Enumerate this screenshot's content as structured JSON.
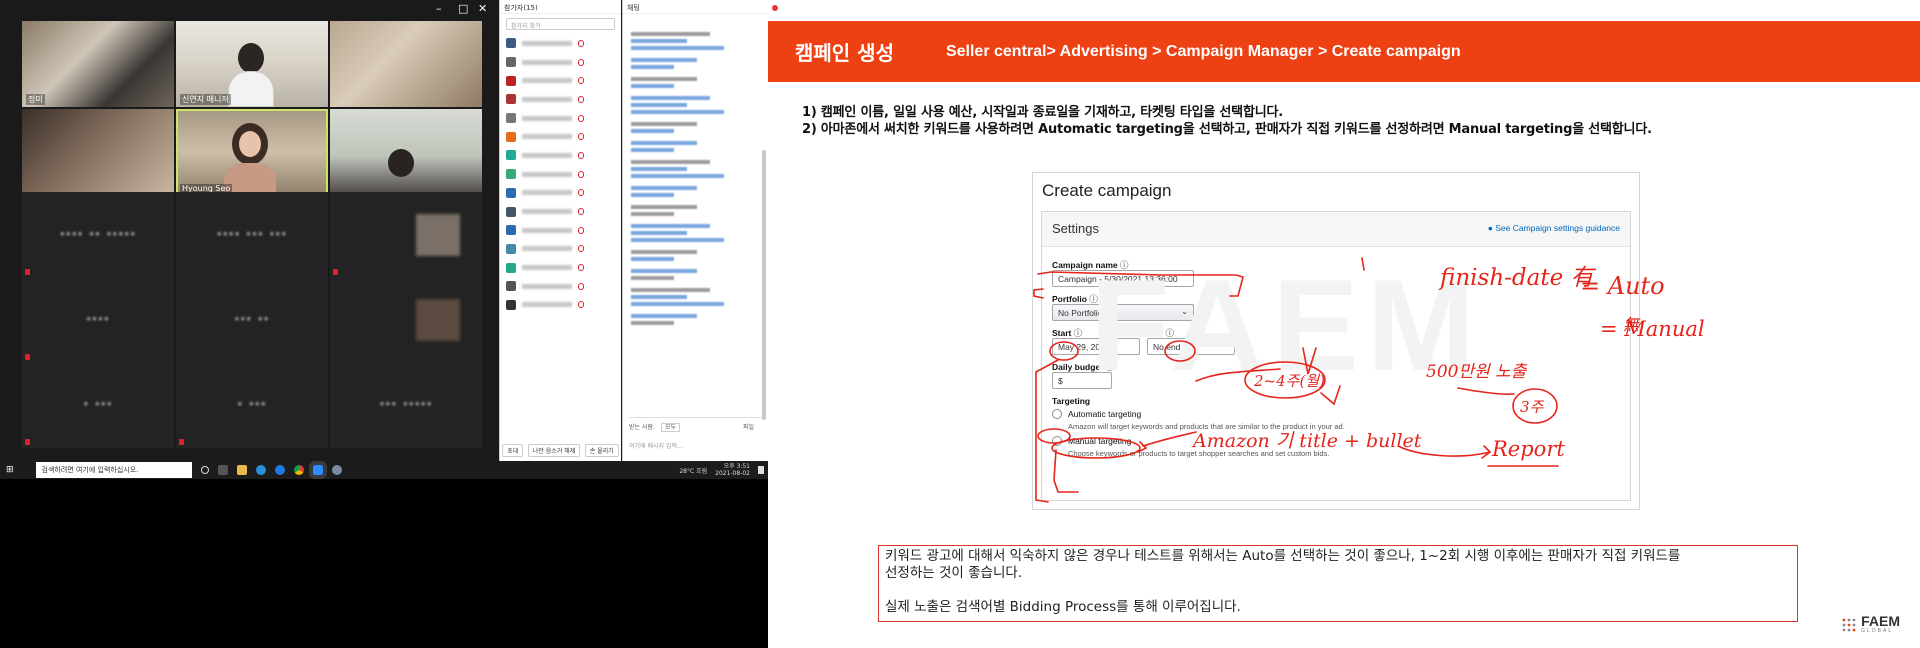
{
  "zoom": {
    "window_controls": [
      "–",
      "□",
      "✕"
    ],
    "tiles": [
      {
        "name": "정미"
      },
      {
        "name": "신연지 매니저"
      },
      {
        "name": ""
      },
      {
        "name": ""
      },
      {
        "name": "Hyoung Seo"
      },
      {
        "name": ""
      },
      {
        "name": "···· ·· ·····"
      },
      {
        "name": "···· ··· ···"
      },
      {
        "name": ""
      },
      {
        "name": "····"
      },
      {
        "name": "··· ··"
      },
      {
        "name": ""
      },
      {
        "name": "· ···"
      },
      {
        "name": "· ···"
      },
      {
        "name": "··· ·····"
      }
    ],
    "participants": {
      "title": "참가자(15)",
      "search_placeholder": "참가자 찾기",
      "count": 15,
      "avatar_colors": [
        "#3d5a80",
        "#666",
        "#b22",
        "#a33",
        "#777",
        "#e86b1a",
        "#2a9",
        "#3a7",
        "#2b6cb0",
        "#456",
        "#2b6cb0",
        "#48a",
        "#2a8",
        "#555",
        "#333"
      ],
      "footer": [
        "초대",
        "나만 음소거 해제",
        "손 올리기"
      ]
    },
    "chat": {
      "title": "채팅",
      "to_label": "받는 사람:",
      "to_value": "모두",
      "file_label": "파일",
      "input_placeholder": "여기에 메시지 입력..."
    }
  },
  "taskbar": {
    "search_placeholder": "검색하려면 여기에 입력하십시오.",
    "weather": "28°C 흐림",
    "time": "오후 3:51",
    "date": "2021-08-02"
  },
  "slide": {
    "title": "캠페인 생성",
    "path": "Seller central> Advertising > Campaign Manager > Create campaign",
    "instruction1": "1) 캠페인 이름, 일일 사용 예산, 시작일과 종료일을 기재하고, 타켓팅 타입을 선택합니다.",
    "instruction2": "2) 아마존에서 써치한 키워드를 사용하려면 Automatic targeting을 선택하고, 판매자가 직접 키워드를 선정하려면 Manual targeting을 선택합니다.",
    "watermark": "FAEM",
    "note_line1": "키워드 광고에 대해서 익숙하지 않은 경우나 테스트를 위해서는 Auto를 선택하는 것이 좋으나, 1~2회 시행 이후에는 판매자가 직접 키워드를",
    "note_line2": "선정하는 것이 좋습니다.",
    "note_line3": "실제 노출은 검색어별 Bidding Process를 통해 이루어집니다.",
    "logo": "FAEM",
    "logo_sub": "GLOBAL",
    "accent": "#ee4113"
  },
  "campaign_form": {
    "heading": "Create campaign",
    "settings_title": "Settings",
    "guidance_link": "See Campaign settings guidance",
    "campaign_name_label": "Campaign name",
    "campaign_name_value": "Campaign - 5/30/2021 13:36:00",
    "portfolio_label": "Portfolio",
    "portfolio_value": "No Portfolio",
    "start_label": "Start",
    "start_value": "May 29, 2021",
    "end_label": "End",
    "end_value": "No end date",
    "budget_label": "Daily budget",
    "budget_currency": "$",
    "targeting_label": "Targeting",
    "auto_label": "Automatic targeting",
    "auto_desc": "Amazon will target keywords and products that are similar to the product in your ad.",
    "manual_label": "Manual targeting",
    "manual_desc": "Choose keywords or products to target shopper searches and set custom bids."
  },
  "annotations": {
    "line1a": "finish-date 有",
    "line1b": "= Auto",
    "line2": "無",
    "line3": "= Manual",
    "days": "2~4주(월)",
    "budget": "500만원 노출",
    "weeks": "3주",
    "amazon": "Amazon 기 title + bullet",
    "report": "Report"
  }
}
